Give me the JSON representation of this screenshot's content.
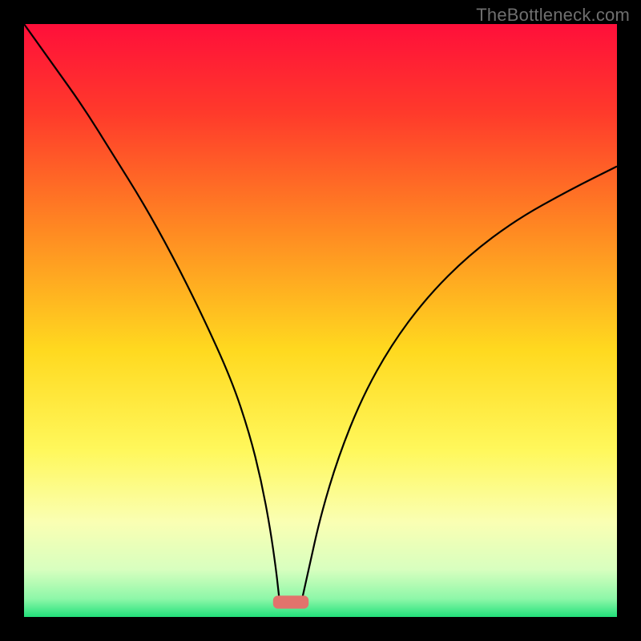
{
  "watermark": {
    "text": "TheBottleneck.com"
  },
  "chart_data": {
    "type": "line",
    "title": "",
    "xlabel": "",
    "ylabel": "",
    "xlim": [
      0,
      100
    ],
    "ylim": [
      0,
      100
    ],
    "grid": false,
    "legend": false,
    "background_gradient_stops": [
      {
        "pos": 0.0,
        "color": "#ff0f3a"
      },
      {
        "pos": 0.15,
        "color": "#ff3a2b"
      },
      {
        "pos": 0.35,
        "color": "#ff8a22"
      },
      {
        "pos": 0.55,
        "color": "#ffd91f"
      },
      {
        "pos": 0.72,
        "color": "#fff85c"
      },
      {
        "pos": 0.84,
        "color": "#faffb3"
      },
      {
        "pos": 0.92,
        "color": "#d8ffbf"
      },
      {
        "pos": 0.97,
        "color": "#8cf7a8"
      },
      {
        "pos": 1.0,
        "color": "#22e07a"
      }
    ],
    "series": [
      {
        "name": "left-curve",
        "x": [
          0,
          5,
          10,
          15,
          20,
          25,
          30,
          35,
          38,
          40,
          41.5,
          42.5,
          43
        ],
        "y": [
          100,
          93,
          86,
          78,
          70,
          61,
          51,
          40,
          31,
          23,
          15,
          8,
          3.5
        ]
      },
      {
        "name": "right-curve",
        "x": [
          47,
          48,
          50,
          53,
          57,
          62,
          68,
          75,
          83,
          92,
          100
        ],
        "y": [
          3.5,
          8,
          17,
          27,
          37,
          46,
          54,
          61,
          67,
          72,
          76
        ]
      }
    ],
    "marker": {
      "name": "min-marker",
      "x_center": 45,
      "y": 2.5,
      "width": 6,
      "height": 2.2,
      "color": "#e2736c"
    }
  }
}
